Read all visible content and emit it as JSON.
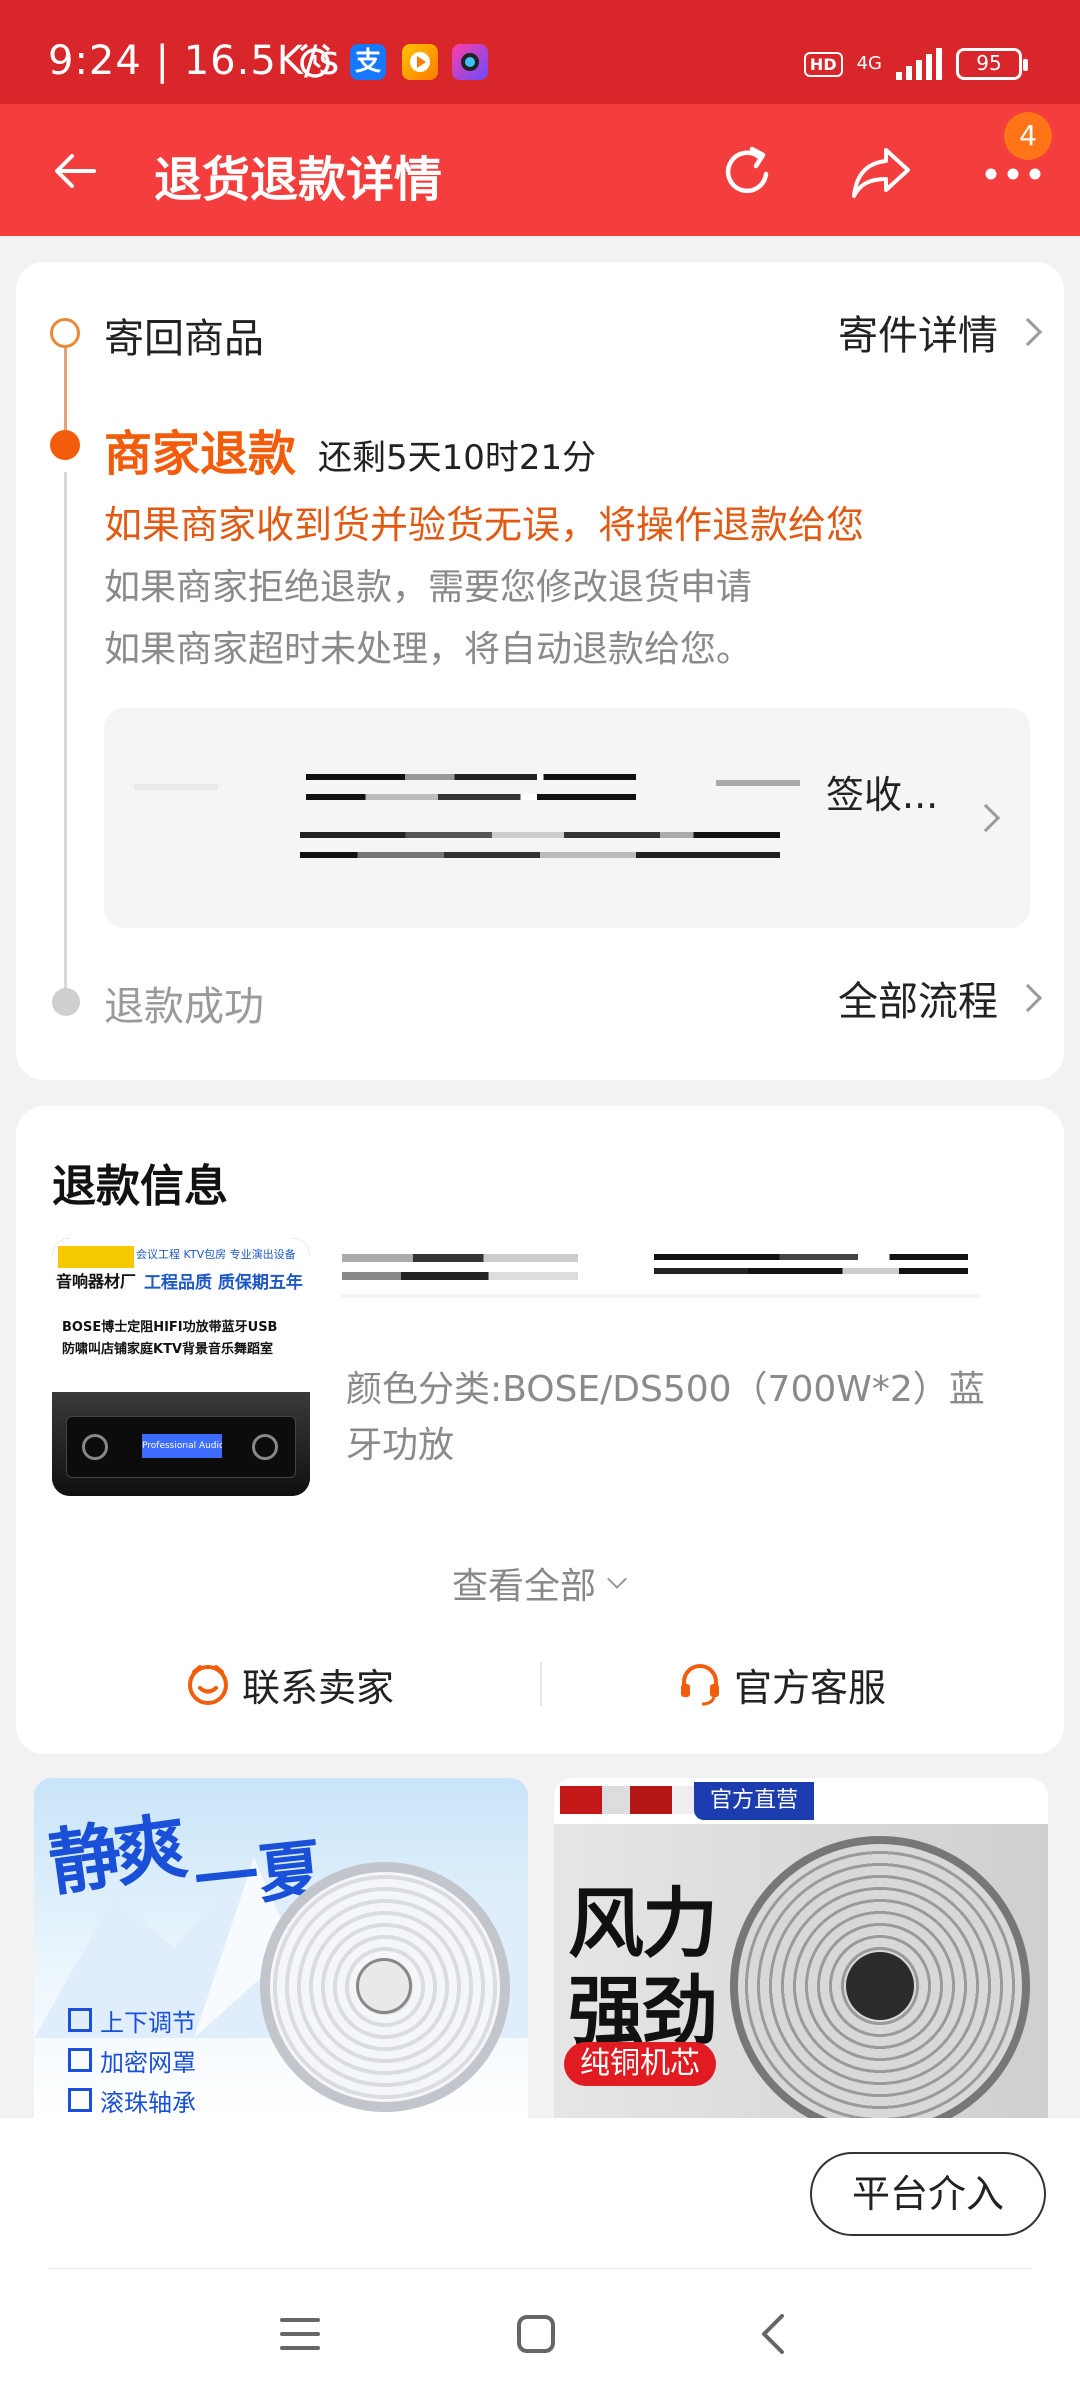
{
  "status_bar": {
    "time": "9:24 | 16.5K/s",
    "hd": "HD",
    "network": "4G",
    "battery": "95",
    "icons": [
      "alarm-icon",
      "alipay-icon",
      "video-app-icon",
      "camera-app-icon"
    ]
  },
  "header": {
    "title": "退货退款详情",
    "more_badge": "4",
    "icons": [
      "back-arrow-icon",
      "refresh-icon",
      "share-icon",
      "more-icon"
    ]
  },
  "progress": {
    "step1_label": "寄回商品",
    "step1_link": "寄件详情",
    "step2_label": "商家退款",
    "step2_countdown": "还剩5天10时21分",
    "step2_highlight": "如果商家收到货并验货无误，将操作退款给您",
    "step2_note1": "如果商家拒绝退款，需要您修改退货申请",
    "step2_note2": "如果商家超时未处理，将自动退款给您。",
    "logistics_status": "签收...",
    "step3_label": "退款成功",
    "step3_link": "全部流程"
  },
  "refund_info": {
    "title": "退款信息",
    "product_sku": "颜色分类:BOSE/DS500（700W*2）蓝牙功放",
    "view_all": "查看全部",
    "contact_seller": "联系卖家",
    "official_service": "官方客服",
    "product_image_text": {
      "top_left": "音响器材厂",
      "top_right1": "会议工程 KTV包房 专业演出设备",
      "top_right2": "工程品质 质保期五年",
      "desc1": "BOSE博士定阻HIFI功放带蓝牙USB",
      "desc2": "防啸叫店铺家庭KTV背景音乐舞蹈室",
      "screen": "Professional Audio"
    }
  },
  "recommendations": [
    {
      "headline1": "静爽",
      "headline2": "一夏",
      "features": [
        "上下调节",
        "加密网罩",
        "滚珠轴承"
      ]
    },
    {
      "tag": "官方直营",
      "headline1": "风力",
      "headline2": "强劲",
      "sub": "纯铜机芯"
    }
  ],
  "footer": {
    "platform_button": "平台介入"
  },
  "colors": {
    "status_bar": "#d8262a",
    "header": "#f43d3d",
    "accent_orange": "#f25c0a",
    "text_dark": "#222222",
    "text_gray": "#888888"
  }
}
